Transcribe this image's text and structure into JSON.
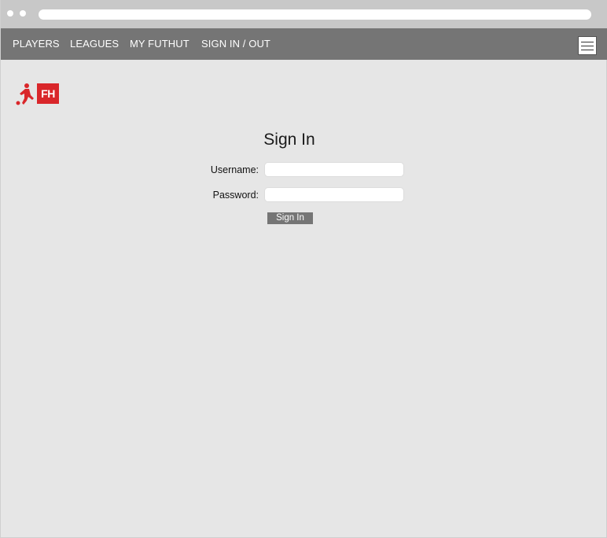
{
  "nav": {
    "players": "PLAYERS",
    "leagues": "LEAGUES",
    "my_futhut": "MY FUTHUT",
    "sign_in_out": "SIGN IN / OUT"
  },
  "logo": {
    "badge_text": "FH",
    "brand_color": "#d9262a"
  },
  "form": {
    "title": "Sign In",
    "username_label": "Username:",
    "username_value": "",
    "password_label": "Password:",
    "password_value": "",
    "submit_label": "Sign In"
  },
  "colors": {
    "navbar": "#757575",
    "background": "#e6e6e6",
    "chrome": "#c8c8c8"
  }
}
